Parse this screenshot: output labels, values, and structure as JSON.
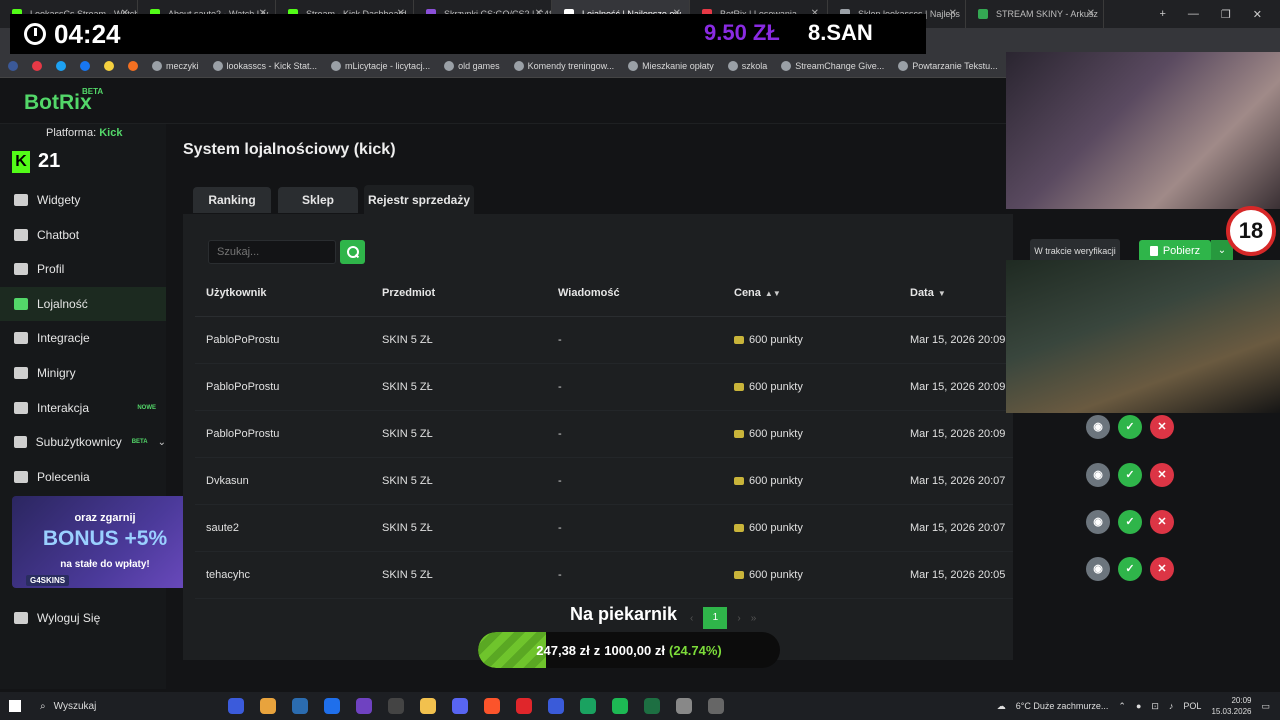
{
  "browser": {
    "tabs": [
      {
        "title": "LookassCs Stream - Watch",
        "active": false
      },
      {
        "title": "About saute2 - Watch Liv",
        "active": false
      },
      {
        "title": "Stream - Kick Dashboard",
        "active": false
      },
      {
        "title": "Skrzynki CS:GO/CS2 | G4S",
        "active": false
      },
      {
        "title": "Lojalność | Najlepsze ow",
        "active": true
      },
      {
        "title": "BotRix | Losowania",
        "active": false
      },
      {
        "title": "Sklep lookasscs | Najleps",
        "active": false
      },
      {
        "title": "STREAM SKINY - Arkusz",
        "active": false
      }
    ],
    "bookmarks": [
      "meczyki",
      "lookasscs - Kick Stat...",
      "mLicytacje - licytacj...",
      "old games",
      "Komendy treningow...",
      "Mieszkanie opłaty",
      "szkola",
      "StreamChange Give...",
      "Powtarzanie Tekstu..."
    ]
  },
  "overlay": {
    "clock": "04:24",
    "donation": "9.50 ZŁ",
    "donor": "8.SAN",
    "goal_title": "Na piekarnik",
    "goal_current": "247,38 zł",
    "goal_sep": "z",
    "goal_target": "1000,00 zł",
    "goal_percent_text": "(24.74%)",
    "goal_fraction": 0.2474,
    "age_badge": "18"
  },
  "sidebar": {
    "logo": "BotRix",
    "logo_badge": "BETA",
    "platform_label": "Platforma:",
    "platform_value": "Kick",
    "kick_viewers": "21",
    "items": [
      {
        "label": "Widgety",
        "icon": "widget-icon",
        "active": false
      },
      {
        "label": "Chatbot",
        "icon": "robot-icon",
        "active": false
      },
      {
        "label": "Profil",
        "icon": "profile-icon",
        "active": false
      },
      {
        "label": "Lojalność",
        "icon": "trophy-icon",
        "active": true
      },
      {
        "label": "Integracje",
        "icon": "integration-icon",
        "active": false
      },
      {
        "label": "Minigry",
        "icon": "gamepad-icon",
        "active": false
      },
      {
        "label": "Interakcja",
        "icon": "music-icon",
        "active": false,
        "badge": "NOWE"
      },
      {
        "label": "Subużytkownicy",
        "icon": "users-icon",
        "active": false,
        "badge": "BETA"
      },
      {
        "label": "Polecenia",
        "icon": "referral-icon",
        "active": false
      }
    ],
    "logout": "Wyloguj Się",
    "promo": {
      "line1": "oraz zgarnij",
      "line2": "BONUS +5%",
      "line3": "na stałe do wpłaty!",
      "brand": "G4SKINS"
    }
  },
  "main": {
    "title": "System lojalnościowy (kick)",
    "tabs": [
      "Ranking",
      "Sklep",
      "Rejestr sprzedaży"
    ],
    "active_tab": 2,
    "search_placeholder": "Szukaj...",
    "verify_label": "W trakcie weryfikacji",
    "download_label": "Pobierz",
    "columns": [
      "Użytkownik",
      "Przedmiot",
      "Wiadomość",
      "Cena",
      "Data"
    ],
    "rows": [
      {
        "user": "PabloPoProstu",
        "item": "SKIN 5 ZŁ",
        "message": "-",
        "price": "600 punkty",
        "date": "Mar 15, 2026 20:09"
      },
      {
        "user": "PabloPoProstu",
        "item": "SKIN 5 ZŁ",
        "message": "-",
        "price": "600 punkty",
        "date": "Mar 15, 2026 20:09"
      },
      {
        "user": "PabloPoProstu",
        "item": "SKIN 5 ZŁ",
        "message": "-",
        "price": "600 punkty",
        "date": "Mar 15, 2026 20:09"
      },
      {
        "user": "Dvkasun",
        "item": "SKIN 5 ZŁ",
        "message": "-",
        "price": "600 punkty",
        "date": "Mar 15, 2026 20:07"
      },
      {
        "user": "saute2",
        "item": "SKIN 5 ZŁ",
        "message": "-",
        "price": "600 punkty",
        "date": "Mar 15, 2026 20:07"
      },
      {
        "user": "tehacyhc",
        "item": "SKIN 5 ZŁ",
        "message": "-",
        "price": "600 punkty",
        "date": "Mar 15, 2026 20:05"
      }
    ],
    "pagination": {
      "current": "1"
    }
  },
  "taskbar": {
    "search": "Wyszukaj",
    "weather": "6°C  Duże zachmurze...",
    "lang": "POL",
    "time": "20:09",
    "date": "15.03.2026"
  }
}
